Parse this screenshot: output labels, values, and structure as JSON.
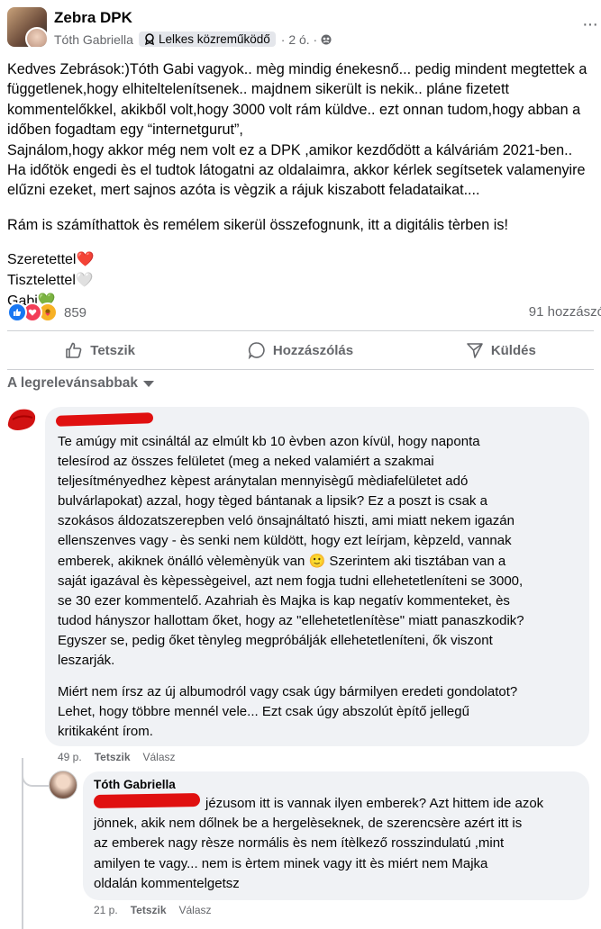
{
  "header": {
    "group_name": "Zebra DPK",
    "author": "Tóth Gabriella",
    "badge": "Lelkes közreműködő",
    "time": "· 2 ó. ·",
    "more": "···"
  },
  "post": {
    "lines": [
      "Kedves Zebrások:)Tóth Gabi vagyok.. mèg mindig énekesnő... pedig mindent megtettek a",
      "függetlenek,hogy elhiteltelenítsenek.. majdnem sikerült is nekik.. pláne fizetett",
      "kommentelőkkel, akikből volt,hogy 3000 volt rám küldve.. ezt onnan tudom,hogy abban a",
      "időben fogadtam egy “internetgurut”,",
      "Sajnálom,hogy akkor még nem volt ez a DPK ,amikor kezdődött a kálváriám 2021-ben..",
      "Ha időtök engedi ès el tudtok látogatni az oldalaimra, akkor kérlek segítsetek valamenyire",
      "elűzni ezeket, mert sajnos azóta is vègzik a rájuk kiszabott feladataikat...."
    ],
    "line2": "Rám is számíthattok ès remélem sikerül összefognunk, itt a digitális tèrben is!",
    "sign1": "Szeretettel",
    "sign1_emoji": "❤️",
    "sign2": "Tisztelettel",
    "sign2_emoji": "🤍",
    "sign3": "Gabi",
    "sign3_emoji": "💚"
  },
  "reactions": {
    "count": "859",
    "comments": "91 hozzászó"
  },
  "actions": {
    "like": "Tetszik",
    "comment": "Hozzászólás",
    "send": "Küldés"
  },
  "sort": {
    "label": "A legrelevánsabbak"
  },
  "comment1": {
    "para1": [
      "Te amúgy mit csináltál az elmúlt kb 10 èvben azon kívül, hogy naponta",
      "telesírod az összes felületet (meg a neked valamiért a szakmai",
      "teljesítményedhez kèpest aránytalan mennyisègű mèdiafelületet adó",
      "bulvárlapokat) azzal, hogy tèged bántanak a lipsik? Ez a poszt is csak a",
      "szokásos áldozatszerepben veló önsajnáltató hiszti, ami miatt nekem igazán",
      "ellenszenves vagy - ès senki nem küldött, hogy ezt leírjam, kèpzeld, vannak",
      "emberek, akiknek önálló vèlemènyük van 🙂 Szerintem aki tisztában van a",
      "saját igazával ès kèpessègeivel, azt nem fogja tudni ellehetetleníteni se 3000,",
      "se 30 ezer kommentelő. Azahriah ès Majka is kap negatív kommenteket, ès",
      "tudod hányszor hallottam őket, hogy az \"ellehetetlenítèse\" miatt panaszkodik?",
      "Egyszer se, pedig őket tènyleg megpróbálják ellehetetleníteni, ők viszont",
      "leszarják."
    ],
    "para2": [
      "Miért nem írsz az új albumodról vagy csak úgy bármilyen eredeti gondolatot?",
      "Lehet, hogy többre mennél vele... Ezt csak úgy abszolút èpítő jellegű",
      "kritikaként írom."
    ],
    "time": "49 p.",
    "like": "Tetszik",
    "reply": "Válasz"
  },
  "reply": {
    "author": "Tóth Gabriella",
    "lines": [
      "jézusom itt is vannak ilyen emberek? Azt hittem ide azok",
      "jönnek, akik nem dőlnek be a hergelèseknek, de szerencsère azért itt is",
      "az emberek nagy rèsze normális ès nem ítèlkező rosszindulatú ,mint",
      "amilyen te vagy... nem is èrtem minek vagy itt ès miért nem Majka",
      "oldalán kommentelgetsz"
    ],
    "time": "21 p.",
    "like": "Tetszik",
    "reply": "Válasz"
  },
  "colors": {
    "accent": "#1877f2",
    "redaction": "#e01010",
    "bubble": "#f0f2f5"
  }
}
